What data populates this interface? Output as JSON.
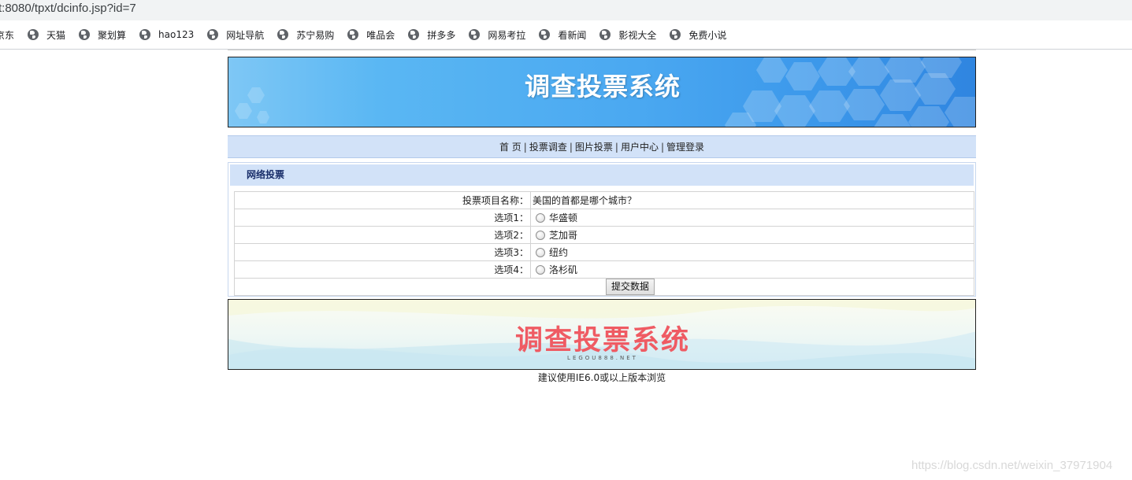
{
  "browser": {
    "address": "t:8080/tpxt/dcinfo.jsp?id=7",
    "bookmarks": [
      "京东",
      "天猫",
      "聚划算",
      "hao123",
      "网址导航",
      "苏宁易购",
      "唯品会",
      "拼多多",
      "网易考拉",
      "看新闻",
      "影视大全",
      "免费小说"
    ]
  },
  "header": {
    "banner_title": "调查投票系统"
  },
  "nav": {
    "items": [
      "首 页",
      "投票调查",
      "图片投票",
      "用户中心",
      "管理登录"
    ],
    "separator": "|"
  },
  "vote": {
    "section_title": "网络投票",
    "project_label": "投票项目名称：",
    "project_value": "美国的首都是哪个城市？",
    "options": [
      {
        "label": "选项1：",
        "text": "华盛顿"
      },
      {
        "label": "选项2：",
        "text": "芝加哥"
      },
      {
        "label": "选项3：",
        "text": "纽约"
      },
      {
        "label": "选项4：",
        "text": "洛杉矶"
      }
    ],
    "submit_label": "提交数据"
  },
  "footer": {
    "banner_title": "调查投票系统",
    "banner_sub": "LEGOU888.NET",
    "notice": "建议使用IE6.0或以上版本浏览"
  },
  "watermark": "https://blog.csdn.net/weixin_37971904",
  "colors": {
    "nav_bg": "#d2e2f8",
    "banner_blue": "#4aa8f1",
    "footer_title": "#ef5b63",
    "section_title": "#1a2f6b"
  }
}
